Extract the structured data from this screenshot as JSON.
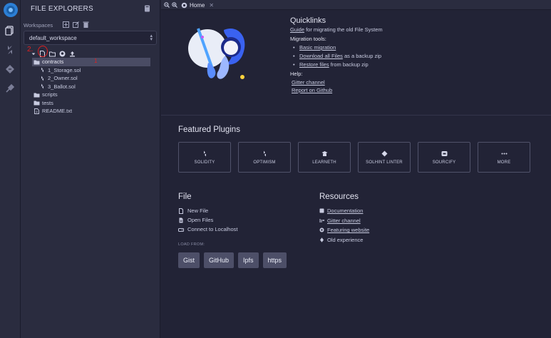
{
  "side_panel": {
    "title": "FILE EXPLORERS",
    "workspaces_label": "Workspaces",
    "workspace_selected": "default_workspace",
    "annotations": {
      "step2": "2.",
      "step1": "1"
    },
    "tree": [
      {
        "label": "contracts",
        "type": "folder",
        "level": 0,
        "selected": true
      },
      {
        "label": "1_Storage.sol",
        "type": "sol",
        "level": 1
      },
      {
        "label": "2_Owner.sol",
        "type": "sol",
        "level": 1
      },
      {
        "label": "3_Ballot.sol",
        "type": "sol",
        "level": 1
      },
      {
        "label": "scripts",
        "type": "folder",
        "level": 0
      },
      {
        "label": "tests",
        "type": "folder",
        "level": 0
      },
      {
        "label": "README.txt",
        "type": "file",
        "level": 0
      }
    ]
  },
  "tabs": {
    "home_label": "Home",
    "close_glyph": "✕"
  },
  "quicklinks": {
    "title": "Quicklinks",
    "guide_link": "Guide",
    "guide_rest": " for migrating the old File System",
    "migration_label": "Migration tools:",
    "basic_migration": "Basic migration",
    "download_link": "Download all Files",
    "download_rest": "  as a backup zip",
    "restore_link": "Restore files",
    "restore_rest": " from backup zip",
    "help_label": "Help:",
    "gitter": "Gitter channel",
    "report": "Report on Github"
  },
  "featured": {
    "title": "Featured Plugins",
    "plugins": [
      "SOLIDITY",
      "OPTIMISM",
      "LEARNETH",
      "SOLHINT LINTER",
      "SOURCIFY",
      "MORE"
    ]
  },
  "file_section": {
    "title": "File",
    "new_file": "New File",
    "open_files": "Open Files",
    "connect": "Connect to Localhost",
    "load_from": "LOAD FROM:",
    "buttons": [
      "Gist",
      "GitHub",
      "Ipfs",
      "https"
    ]
  },
  "resources": {
    "title": "Resources",
    "documentation": "Documentation",
    "gitter": "Gitter channel",
    "website": "Featuring website",
    "old_experience": "Old experience"
  },
  "colors": {
    "bg": "#222336",
    "panel": "#2a2c3f",
    "accent": "#2c7fd6",
    "annotation": "#e02020"
  }
}
